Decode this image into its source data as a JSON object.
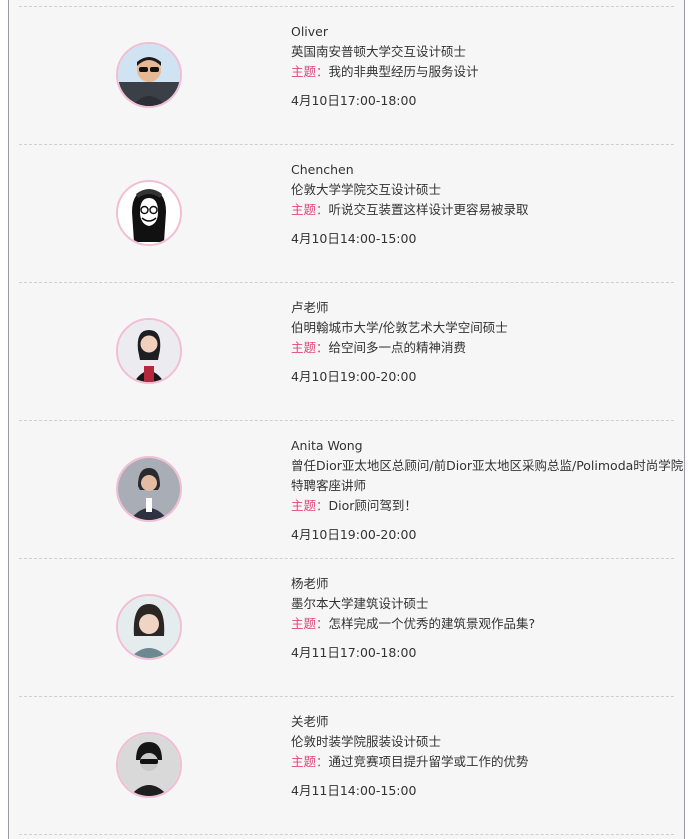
{
  "accent_color": "#e0487c",
  "speakers": [
    {
      "name": "Oliver",
      "degree": "英国南安普顿大学交互设计硕士",
      "topic_label": "主题：",
      "topic": "我的非典型经历与服务设计",
      "time": "4月10日17:00-18:00"
    },
    {
      "name": "Chenchen",
      "degree": "伦敦大学学院交互设计硕士",
      "topic_label": "主题：",
      "topic": "听说交互装置这样设计更容易被录取",
      "time": "4月10日14:00-15:00"
    },
    {
      "name": "卢老师",
      "degree": "伯明翰城市大学/伦敦艺术大学空间硕士",
      "topic_label": "主题：",
      "topic": "给空间多一点的精神消费",
      "time": "4月10日19:00-20:00"
    },
    {
      "name": "Anita Wong",
      "degree": "曾任Dior亚太地区总顾问/前Dior亚太地区采购总监/Polimoda时尚学院特聘客座讲师",
      "topic_label": "主题：",
      "topic": "Dior顾问驾到！",
      "time": "4月10日19:00-20:00"
    },
    {
      "name": "杨老师",
      "degree": "墨尔本大学建筑设计硕士",
      "topic_label": "主题：",
      "topic": "怎样完成一个优秀的建筑景观作品集?",
      "time": "4月11日17:00-18:00"
    },
    {
      "name": "关老师",
      "degree": "伦敦时装学院服装设计硕士",
      "topic_label": "主题：",
      "topic": "通过竞赛项目提升留学或工作的优势",
      "time": "4月11日14:00-15:00"
    }
  ]
}
